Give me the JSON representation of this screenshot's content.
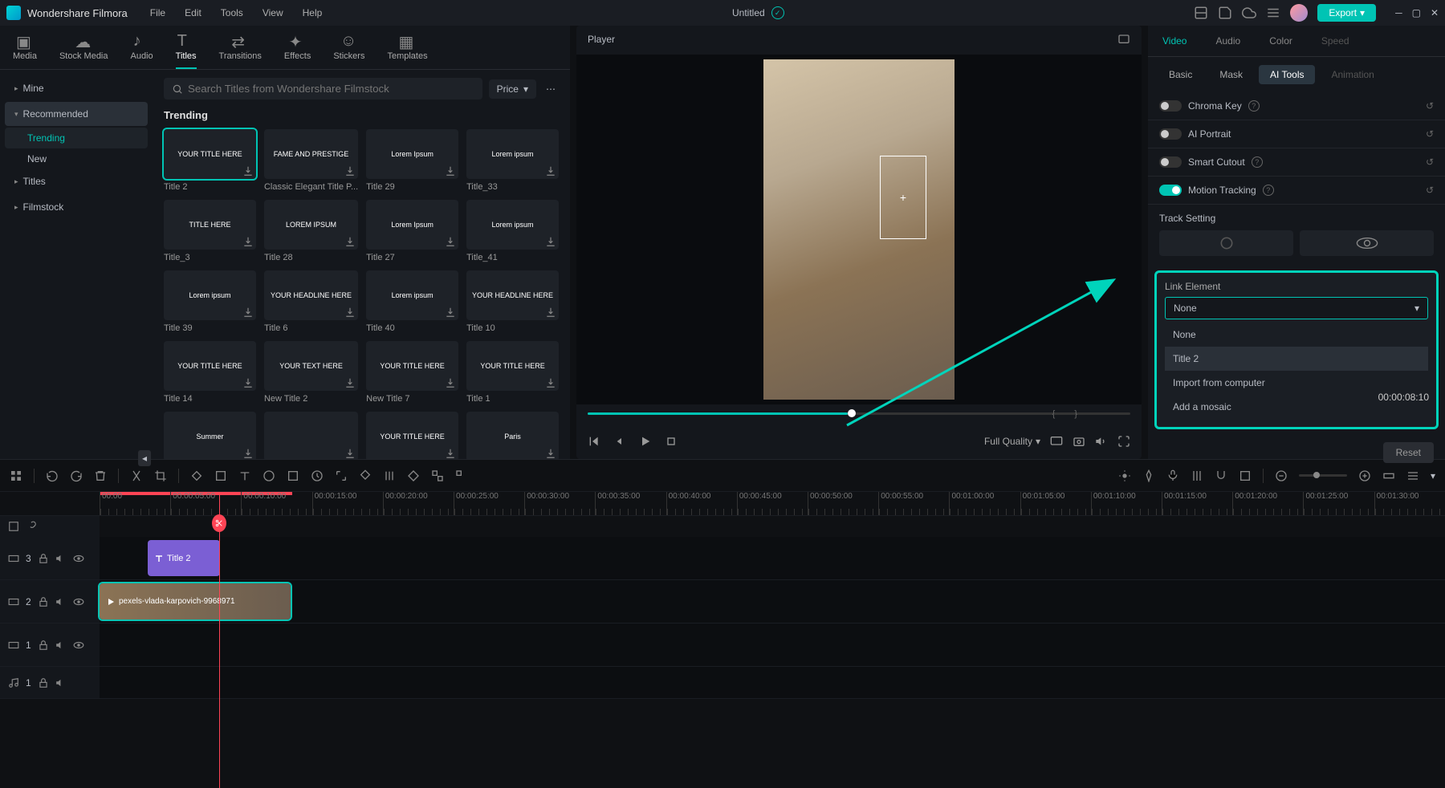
{
  "app": {
    "name": "Wondershare Filmora",
    "document": "Untitled"
  },
  "menubar": [
    "File",
    "Edit",
    "Tools",
    "View",
    "Help"
  ],
  "export_label": "Export",
  "media_tabs": [
    {
      "label": "Media"
    },
    {
      "label": "Stock Media"
    },
    {
      "label": "Audio"
    },
    {
      "label": "Titles"
    },
    {
      "label": "Transitions"
    },
    {
      "label": "Effects"
    },
    {
      "label": "Stickers"
    },
    {
      "label": "Templates"
    }
  ],
  "active_media_tab": "Titles",
  "sidebar": {
    "items": [
      {
        "label": "Mine",
        "expandable": true
      },
      {
        "label": "Recommended",
        "expandable": true,
        "expanded": true,
        "children": [
          {
            "label": "Trending",
            "active": true
          },
          {
            "label": "New"
          }
        ]
      },
      {
        "label": "Titles",
        "expandable": true
      },
      {
        "label": "Filmstock",
        "expandable": true
      }
    ]
  },
  "search": {
    "placeholder": "Search Titles from Wondershare Filmstock"
  },
  "price_label": "Price",
  "section_title": "Trending",
  "titles": [
    {
      "label": "Title 2",
      "thumb": "YOUR TITLE HERE",
      "selected": true
    },
    {
      "label": "Classic Elegant Title P...",
      "thumb": "FAME AND PRESTIGE"
    },
    {
      "label": "Title 29",
      "thumb": "Lorem Ipsum"
    },
    {
      "label": "Title_33",
      "thumb": "Lorem ipsum"
    },
    {
      "label": "Title_3",
      "thumb": "TITLE HERE"
    },
    {
      "label": "Title 28",
      "thumb": "LOREM IPSUM"
    },
    {
      "label": "Title 27",
      "thumb": "Lorem Ipsum"
    },
    {
      "label": "Title_41",
      "thumb": "Lorem ipsum"
    },
    {
      "label": "Title 39",
      "thumb": "Lorem ipsum"
    },
    {
      "label": "Title 6",
      "thumb": "YOUR HEADLINE HERE"
    },
    {
      "label": "Title 40",
      "thumb": "Lorem ipsum"
    },
    {
      "label": "Title 10",
      "thumb": "YOUR HEADLINE HERE"
    },
    {
      "label": "Title 14",
      "thumb": "YOUR TITLE HERE"
    },
    {
      "label": "New Title 2",
      "thumb": "YOUR TEXT HERE"
    },
    {
      "label": "New Title 7",
      "thumb": "YOUR TITLE HERE"
    },
    {
      "label": "Title 1",
      "thumb": "YOUR TITLE HERE"
    },
    {
      "label": "",
      "thumb": "Summer"
    },
    {
      "label": "",
      "thumb": ""
    },
    {
      "label": "",
      "thumb": "YOUR TITLE HERE"
    },
    {
      "label": "",
      "thumb": "Paris"
    }
  ],
  "player": {
    "title": "Player",
    "timecode": "00:00:08:10",
    "quality": "Full Quality"
  },
  "right_tabs": {
    "items": [
      "Video",
      "Audio",
      "Color",
      "Speed"
    ],
    "active": "Video",
    "disabled": [
      "Speed"
    ]
  },
  "right_subtabs": {
    "items": [
      "Basic",
      "Mask",
      "AI Tools",
      "Animation"
    ],
    "active": "AI Tools",
    "disabled": [
      "Animation"
    ]
  },
  "ai_tools": [
    {
      "label": "Chroma Key",
      "on": false,
      "info": true
    },
    {
      "label": "AI Portrait",
      "on": false
    },
    {
      "label": "Smart Cutout",
      "on": false,
      "info": true
    },
    {
      "label": "Motion Tracking",
      "on": true,
      "info": true
    }
  ],
  "track_setting_label": "Track Setting",
  "link_element": {
    "label": "Link Element",
    "value": "None",
    "options": [
      "None",
      "Title 2",
      "Import from computer",
      "Add a mosaic"
    ]
  },
  "reset_label": "Reset",
  "timeline": {
    "ruler": [
      "00:00",
      "00:00:05:00",
      "00:00:10:00",
      "00:00:15:00",
      "00:00:20:00",
      "00:00:25:00",
      "00:00:30:00",
      "00:00:35:00",
      "00:00:40:00",
      "00:00:45:00",
      "00:00:50:00",
      "00:00:55:00",
      "00:01:00:00",
      "00:01:05:00",
      "00:01:10:00",
      "00:01:15:00",
      "00:01:20:00",
      "00:01:25:00",
      "00:01:30:00"
    ],
    "tracks": [
      {
        "id": "3",
        "type": "video"
      },
      {
        "id": "2",
        "type": "video"
      },
      {
        "id": "1",
        "type": "video"
      },
      {
        "id": "1",
        "type": "audio"
      }
    ],
    "title_clip_label": "Title 2",
    "video_clip_label": "pexels-vlada-karpovich-9968971"
  }
}
